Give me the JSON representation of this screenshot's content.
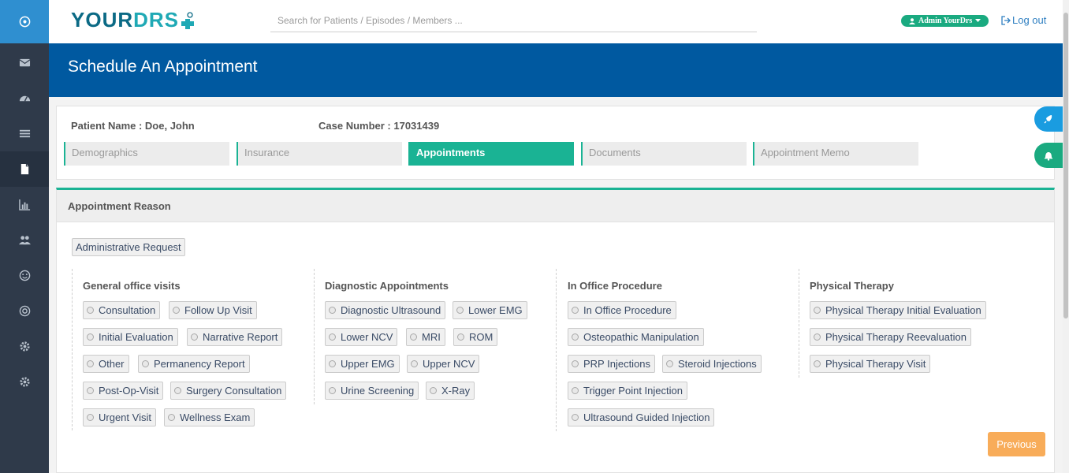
{
  "app": {
    "logo_text_a": "YOUR",
    "logo_text_b": "DRS",
    "search_placeholder": "Search for Patients / Episodes / Members ...",
    "user_label": "Admin YourDrs",
    "logout_label": "Log out"
  },
  "sidebar": {
    "items": [
      {
        "icon": "power-icon"
      },
      {
        "icon": "envelope-icon"
      },
      {
        "icon": "dashboard-icon"
      },
      {
        "icon": "list-icon"
      },
      {
        "icon": "file-icon",
        "active": true
      },
      {
        "icon": "bar-chart-icon"
      },
      {
        "icon": "users-icon"
      },
      {
        "icon": "smile-icon"
      },
      {
        "icon": "support-icon"
      },
      {
        "icon": "gear-icon"
      },
      {
        "icon": "gear-icon"
      }
    ]
  },
  "page": {
    "title": "Schedule An Appointment"
  },
  "patient": {
    "name_label": "Patient Name : Doe, John",
    "case_label": "Case Number : 17031439"
  },
  "tabs": [
    "Demographics",
    "Insurance",
    "Appointments",
    "Documents",
    "Appointment Memo"
  ],
  "active_tab": "Appointments",
  "reason": {
    "heading": "Appointment Reason",
    "admin_request": "Administrative Request",
    "columns": [
      {
        "title": "General office visits",
        "options": [
          "Consultation",
          "Follow Up Visit",
          "Initial Evaluation",
          "Narrative Report",
          "Other",
          "Permanency Report",
          "Post-Op-Visit",
          "Surgery Consultation",
          "Urgent Visit",
          "Wellness Exam"
        ]
      },
      {
        "title": "Diagnostic Appointments",
        "options": [
          "Diagnostic Ultrasound",
          "Lower EMG",
          "Lower NCV",
          "MRI",
          "ROM",
          "Upper EMG",
          "Upper NCV",
          "Urine Screening",
          "X-Ray"
        ]
      },
      {
        "title": "In Office Procedure",
        "options": [
          "In Office Procedure",
          "Osteopathic Manipulation",
          "PRP Injections",
          "Steroid Injections",
          "Trigger Point Injection",
          "Ultrasound Guided Injection"
        ]
      },
      {
        "title": "Physical Therapy",
        "options": [
          "Physical Therapy Initial Evaluation",
          "Physical Therapy Reevaluation",
          "Physical Therapy Visit"
        ]
      }
    ],
    "previous_label": "Previous"
  },
  "colors": {
    "primary_blue": "#0059a0",
    "accent_green": "#1ab394",
    "sidebar": "#2f3a4a",
    "orange": "#f8ac59"
  }
}
